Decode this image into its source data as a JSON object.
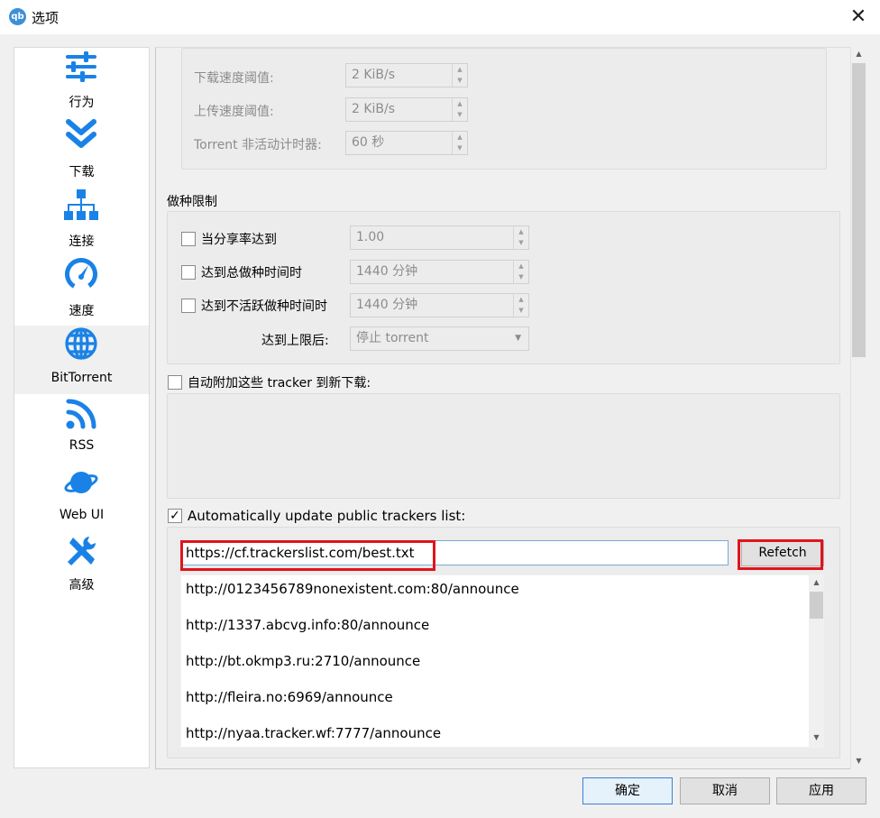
{
  "window": {
    "title": "选项",
    "app_icon": "qb"
  },
  "sidebar": {
    "items": [
      {
        "label": "行为",
        "icon": "sliders-icon"
      },
      {
        "label": "下载",
        "icon": "double-chevron-down-icon"
      },
      {
        "label": "连接",
        "icon": "network-icon"
      },
      {
        "label": "速度",
        "icon": "speedometer-icon"
      },
      {
        "label": "BitTorrent",
        "icon": "globe-icon",
        "selected": true
      },
      {
        "label": "RSS",
        "icon": "rss-icon"
      },
      {
        "label": "Web UI",
        "icon": "planet-icon"
      },
      {
        "label": "高级",
        "icon": "tools-icon"
      }
    ]
  },
  "inactive_torrents": {
    "download_threshold_label": "下载速度阈值:",
    "download_threshold_value": "2 KiB/s",
    "upload_threshold_label": "上传速度阈值:",
    "upload_threshold_value": "2 KiB/s",
    "timer_label": "Torrent 非活动计时器:",
    "timer_value": "60 秒"
  },
  "seeding_limits": {
    "title": "做种限制",
    "ratio_label": "当分享率达到",
    "ratio_value": "1.00",
    "total_time_label": "达到总做种时间时",
    "total_time_value": "1440 分钟",
    "inactive_time_label": "达到不活跃做种时间时",
    "inactive_time_value": "1440 分钟",
    "action_label": "达到上限后:",
    "action_value": "停止 torrent"
  },
  "auto_add_trackers": {
    "label": "自动附加这些 tracker 到新下载:",
    "checked": false
  },
  "auto_update_trackers": {
    "label": "Automatically update public trackers list:",
    "checked": true,
    "checkmark": "✓",
    "url": "https://cf.trackerslist.com/best.txt",
    "refetch_label": "Refetch",
    "trackers": [
      "http://0123456789nonexistent.com:80/announce",
      "http://1337.abcvg.info:80/announce",
      "http://bt.okmp3.ru:2710/announce",
      "http://fleira.no:6969/announce",
      "http://nyaa.tracker.wf:7777/announce"
    ]
  },
  "buttons": {
    "ok": "确定",
    "cancel": "取消",
    "apply": "应用"
  },
  "colors": {
    "accent": "#1a82e6",
    "highlight": "#e0141c"
  }
}
